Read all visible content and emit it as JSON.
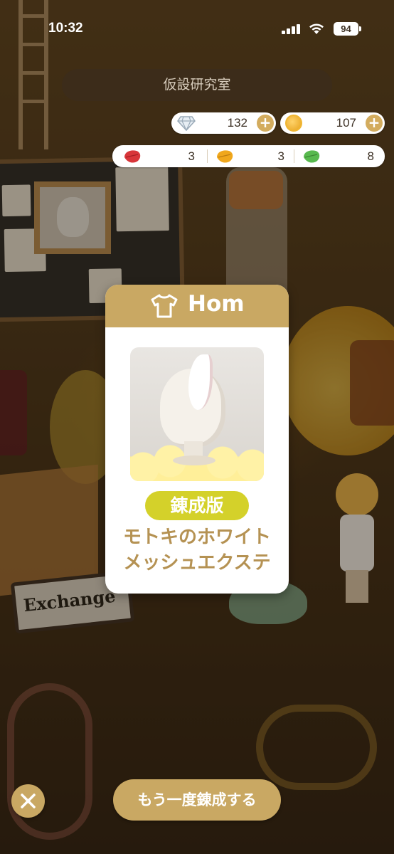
{
  "status_bar": {
    "time": "10:32",
    "battery": "94",
    "icons": [
      "signal-icon",
      "wifi-icon",
      "battery-icon"
    ]
  },
  "header": {
    "title": "仮設研究室"
  },
  "currencies": {
    "gem": {
      "icon": "diamond-icon",
      "value": "132"
    },
    "coin": {
      "icon": "coin-icon",
      "value": "107"
    }
  },
  "leaves": [
    {
      "icon": "red-leaf-icon",
      "color": "#d8363a",
      "value": "3"
    },
    {
      "icon": "orange-leaf-icon",
      "color": "#f0a71c",
      "value": "3"
    },
    {
      "icon": "green-leaf-icon",
      "color": "#58b94e",
      "value": "8"
    }
  ],
  "result_card": {
    "category_icon": "shirt-icon",
    "category_label": "Hom",
    "badge": "錬成版",
    "item_name_line1": "モトキのホワイト",
    "item_name_line2": "メッシュエクステ"
  },
  "scene": {
    "exchange_sign": "Exchange"
  },
  "actions": {
    "close_icon": "close-icon",
    "retry_label": "もう一度錬成する"
  },
  "colors": {
    "accent_gold": "#c9a863",
    "badge_yellow": "#d4d12a",
    "name_gold": "#b59253"
  }
}
